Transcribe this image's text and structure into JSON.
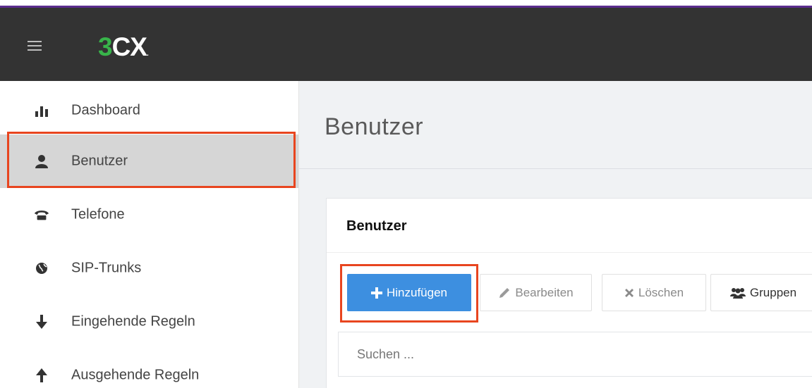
{
  "app": {
    "logo_number": "3",
    "logo_letters": "CX",
    "logo_suffix": "."
  },
  "sidebar": {
    "items": [
      {
        "label": "Dashboard",
        "icon": "bar-chart-icon"
      },
      {
        "label": "Benutzer",
        "icon": "user-icon",
        "active": true
      },
      {
        "label": "Telefone",
        "icon": "phone-icon"
      },
      {
        "label": "SIP-Trunks",
        "icon": "globe-icon"
      },
      {
        "label": "Eingehende Regeln",
        "icon": "arrow-down-icon"
      },
      {
        "label": "Ausgehende Regeln",
        "icon": "arrow-up-icon"
      }
    ]
  },
  "main": {
    "page_title": "Benutzer",
    "panel": {
      "title": "Benutzer",
      "toolbar": {
        "add_label": "Hinzufügen",
        "edit_label": "Bearbeiten",
        "delete_label": "Löschen",
        "groups_label": "Gruppen"
      },
      "search": {
        "placeholder": "Suchen ..."
      }
    }
  },
  "colors": {
    "topbar": "#333333",
    "accent_purple": "#5b2d8e",
    "logo_green": "#38b44a",
    "primary_button": "#3d8fe0",
    "highlight": "#e8451f"
  }
}
